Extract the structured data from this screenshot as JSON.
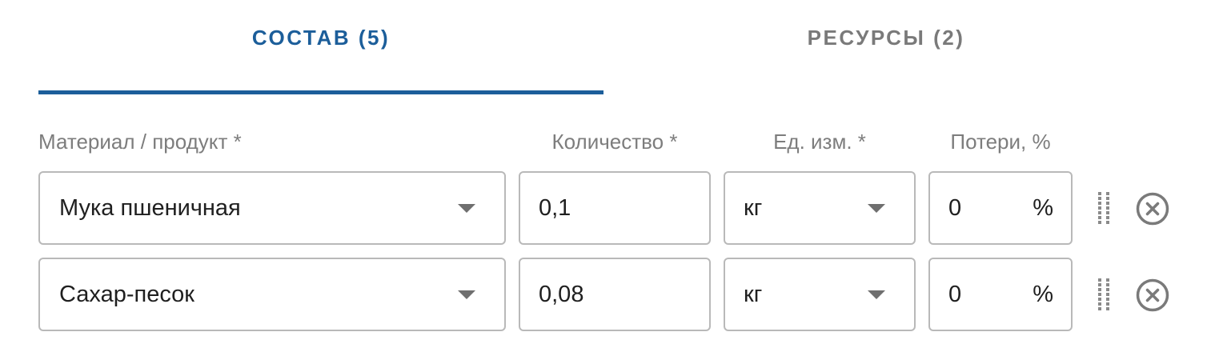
{
  "tabs": [
    {
      "label": "СОСТАВ (5)",
      "active": true,
      "color": "#1c5e9a"
    },
    {
      "label": "РЕСУРСЫ (2)",
      "active": false,
      "color": "#7a7a7a"
    }
  ],
  "columns": {
    "material": "Материал / продукт *",
    "quantity": "Количество *",
    "unit": "Ед. изм. *",
    "loss": "Потери, %"
  },
  "rows": [
    {
      "material": "Мука пшеничная",
      "quantity": "0,1",
      "unit": "кг",
      "loss": "0",
      "loss_suffix": "%"
    },
    {
      "material": "Сахар-песок",
      "quantity": "0,08",
      "unit": "кг",
      "loss": "0",
      "loss_suffix": "%"
    }
  ],
  "icons": {
    "dropdown": "chevron-down-icon",
    "drag": "drag-handle-icon",
    "remove": "close-circle-icon"
  },
  "colors": {
    "accent": "#1c5e9a",
    "border": "#b9b9b9",
    "muted_text": "#7d7d7d",
    "icon": "#7a7a7a"
  }
}
